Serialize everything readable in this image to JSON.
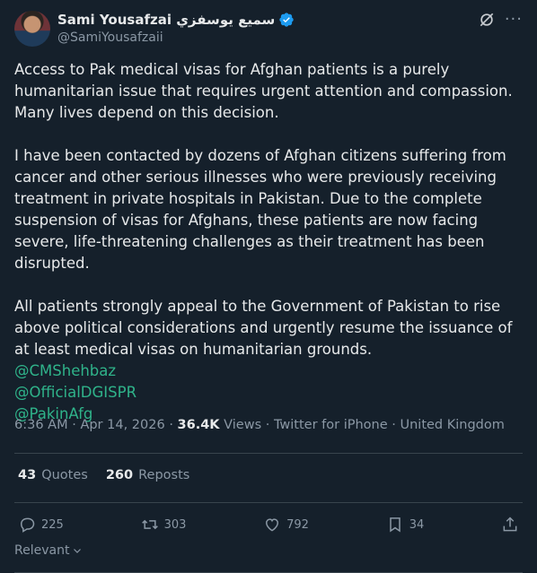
{
  "author": {
    "display_name": "Sami Yousafzai سمیع یوسفزي",
    "handle": "@SamiYousafzaii"
  },
  "tweet": {
    "paragraphs": [
      "Access to Pak medical visas for Afghan patients is a purely humanitarian issue that requires urgent attention and compassion. Many lives depend on this decision.",
      "I have been contacted by dozens of Afghan citizens suffering from cancer and other serious illnesses who were previously receiving treatment in private hospitals in Pakistan. Due to the complete suspension of visas for Afghans, these patients are now facing severe, life-threatening challenges as their treatment has been disrupted.",
      "All patients strongly appeal to the Government of Pakistan to rise above political considerations and urgently resume the issuance of at least medical visas on humanitarian grounds."
    ],
    "mentions": [
      "@CMShehbaz",
      "@OfficialDGISPR",
      "@PakinAfg"
    ]
  },
  "meta": {
    "time": "6:36 AM",
    "date": "Apr 14, 2026",
    "views_count": "36.4K",
    "views_label": "Views",
    "source": "Twitter for iPhone",
    "location": "United Kingdom"
  },
  "stats": {
    "quotes_count": "43",
    "quotes_label": "Quotes",
    "reposts_count": "260",
    "reposts_label": "Reposts"
  },
  "actions": {
    "replies": "225",
    "reposts": "303",
    "likes": "792",
    "bookmarks": "34"
  },
  "sort": {
    "label": "Relevant"
  },
  "icons": [
    "verified-icon",
    "grok-icon",
    "more-icon",
    "reply-icon",
    "repost-icon",
    "like-icon",
    "bookmark-icon",
    "share-icon",
    "chevron-down-icon"
  ],
  "colors": {
    "background": "#15202b",
    "verified": "#1d9bf0",
    "mention": "#2fb38a",
    "muted": "#8b98a5"
  }
}
